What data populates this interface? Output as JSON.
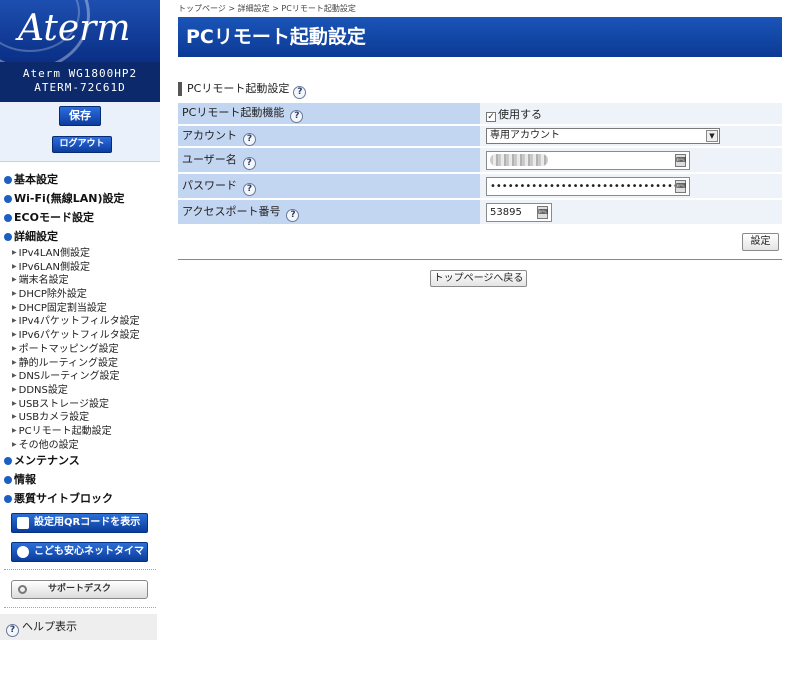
{
  "sidebar": {
    "logo": "Aterm",
    "model": "Aterm WG1800HP2",
    "device": "ATERM-72C61D",
    "save_label": "保存",
    "logout_label": "ログアウト",
    "nav": [
      {
        "label": "基本設定"
      },
      {
        "label": "Wi-Fi(無線LAN)設定"
      },
      {
        "label": "ECOモード設定"
      },
      {
        "label": "詳細設定"
      }
    ],
    "detail_items": [
      "IPv4LAN側設定",
      "IPv6LAN側設定",
      "端末名設定",
      "DHCP除外設定",
      "DHCP固定割当設定",
      "IPv4パケットフィルタ設定",
      "IPv6パケットフィルタ設定",
      "ポートマッピング設定",
      "静的ルーティング設定",
      "DNSルーティング設定",
      "DDNS設定",
      "USBストレージ設定",
      "USBカメラ設定",
      "PCリモート起動設定",
      "その他の設定"
    ],
    "nav_bottom": [
      {
        "label": "メンテナンス"
      },
      {
        "label": "情報"
      },
      {
        "label": "悪質サイトブロック"
      }
    ],
    "qr_label": "設定用QRコードを表示",
    "timer_label": "こども安心ネットタイマー",
    "support_label": "サポートデスク",
    "help_label": "ヘルプ表示"
  },
  "main": {
    "breadcrumb": "トップページ > 詳細設定 > PCリモート起動設定",
    "title": "PCリモート起動設定",
    "section_title": "PCリモート起動設定",
    "rows": {
      "function_label": "PCリモート起動機能",
      "function_value": "使用する",
      "account_label": "アカウント",
      "account_value": "専用アカウント",
      "username_label": "ユーザー名",
      "password_label": "パスワード",
      "password_value": "••••••••••••••••••••••••••••••••",
      "port_label": "アクセスポート番号",
      "port_value": "53895"
    },
    "set_label": "設定",
    "back_label": "トップページへ戻る"
  },
  "colors": {
    "header": "#0c3a95",
    "label_bg": "#c3d6f1",
    "value_bg": "#eef3fa"
  }
}
